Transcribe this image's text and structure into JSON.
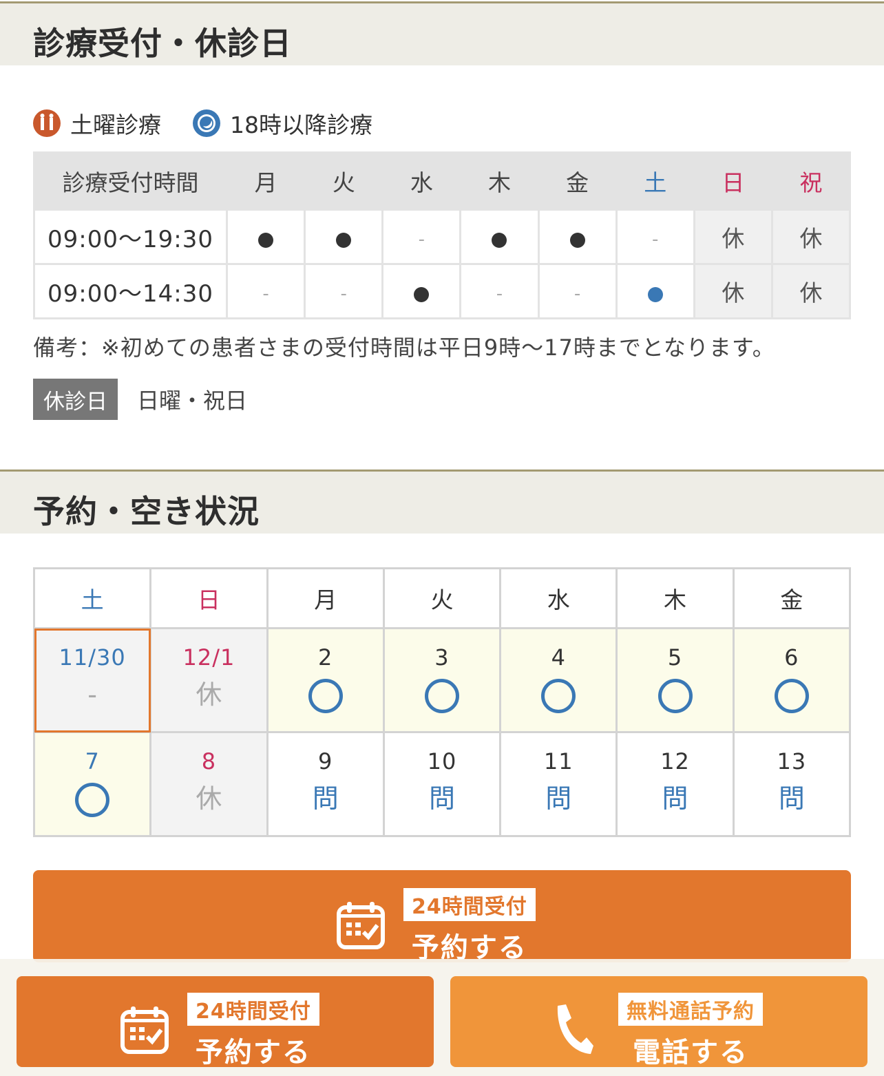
{
  "hours_section": {
    "title": "診療受付・休診日",
    "legend": [
      {
        "icon": "saturday-clinic-icon",
        "label": "土曜診療"
      },
      {
        "icon": "moon-icon",
        "label": "18時以降診療"
      }
    ],
    "table": {
      "header": [
        "診療受付時間",
        "月",
        "火",
        "水",
        "木",
        "金",
        "土",
        "日",
        "祝"
      ],
      "rows": [
        {
          "time": "09:00〜19:30",
          "cells": [
            "●",
            "●",
            "-",
            "●",
            "●",
            "-",
            "休",
            "休"
          ]
        },
        {
          "time": "09:00〜14:30",
          "cells": [
            "-",
            "-",
            "●",
            "-",
            "-",
            "●",
            "休",
            "休"
          ]
        }
      ]
    },
    "note": "備考：※初めての患者さまの受付時間は平日9時〜17時までとなります。",
    "closed_label": "休診日",
    "closed_days": "日曜・祝日"
  },
  "reservation_section": {
    "title": "予約・空き状況",
    "weekdays": [
      "土",
      "日",
      "月",
      "火",
      "水",
      "木",
      "金"
    ],
    "weeks": [
      [
        {
          "date": "11/30",
          "mark": "-"
        },
        {
          "date": "12/1",
          "mark": "休"
        },
        {
          "date": "2",
          "mark": "○"
        },
        {
          "date": "3",
          "mark": "○"
        },
        {
          "date": "4",
          "mark": "○"
        },
        {
          "date": "5",
          "mark": "○"
        },
        {
          "date": "6",
          "mark": "○"
        }
      ],
      [
        {
          "date": "7",
          "mark": "○"
        },
        {
          "date": "8",
          "mark": "休"
        },
        {
          "date": "9",
          "mark": "問"
        },
        {
          "date": "10",
          "mark": "問"
        },
        {
          "date": "11",
          "mark": "問"
        },
        {
          "date": "12",
          "mark": "問"
        },
        {
          "date": "13",
          "mark": "問"
        }
      ]
    ],
    "reserve_button": {
      "tag": "24時間受付",
      "label": "予約する"
    }
  },
  "bottom_bar": {
    "reserve": {
      "tag": "24時間受付",
      "label": "予約する"
    },
    "phone": {
      "tag": "無料通話予約",
      "label": "電話する"
    }
  },
  "colors": {
    "accent": "#e2772d",
    "phone": "#f0953a",
    "saturday": "#3a78b5",
    "sunday": "#c9305f"
  }
}
